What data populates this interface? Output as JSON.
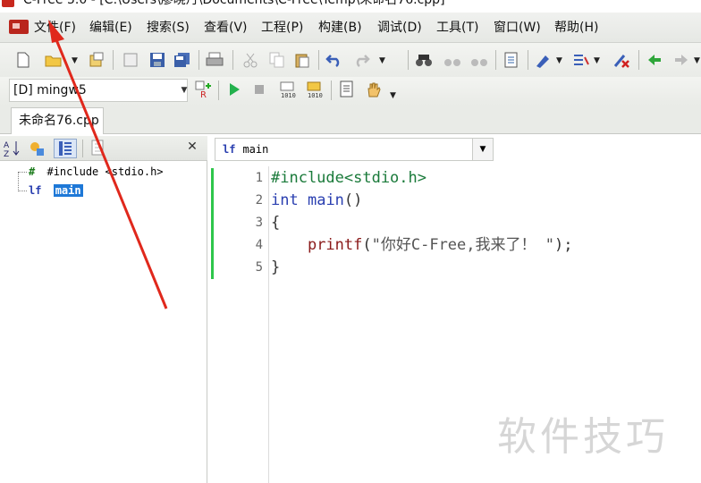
{
  "window": {
    "title": "C-Free 5.0 - [C:\\Users\\廖晓丹\\Documents\\C-Free\\Temp\\未命名76.cpp]"
  },
  "menu": [
    {
      "id": "file",
      "label": "文件(F)"
    },
    {
      "id": "edit",
      "label": "编辑(E)"
    },
    {
      "id": "search",
      "label": "搜索(S)"
    },
    {
      "id": "view",
      "label": "查看(V)"
    },
    {
      "id": "project",
      "label": "工程(P)"
    },
    {
      "id": "build",
      "label": "构建(B)"
    },
    {
      "id": "debug",
      "label": "调试(D)"
    },
    {
      "id": "tools",
      "label": "工具(T)"
    },
    {
      "id": "window",
      "label": "窗口(W)"
    },
    {
      "id": "help",
      "label": "帮助(H)"
    }
  ],
  "toolbar": {
    "compiler_select": "[D] mingw5"
  },
  "tabs": [
    {
      "label": "未命名76.cpp",
      "active": true
    }
  ],
  "symbols": {
    "items": [
      {
        "icon": "hash-icon",
        "label": "#include <stdio.h>"
      },
      {
        "icon": "function-icon",
        "label": "main",
        "selected": true
      }
    ]
  },
  "editor": {
    "function_combo": "main",
    "function_combo_icon": "function-icon",
    "lines": [
      {
        "num": "1",
        "parts": [
          {
            "cls": "c-pre",
            "text": "#include<stdio.h>"
          }
        ]
      },
      {
        "num": "2",
        "parts": [
          {
            "cls": "c-kw",
            "text": "int"
          },
          {
            "cls": "c-pun",
            "text": " "
          },
          {
            "cls": "c-kw",
            "text": "main"
          },
          {
            "cls": "c-pun",
            "text": "()"
          }
        ]
      },
      {
        "num": "3",
        "parts": [
          {
            "cls": "c-pun",
            "text": "{"
          }
        ]
      },
      {
        "num": "4",
        "parts": [
          {
            "cls": "c-pun",
            "text": "    "
          },
          {
            "cls": "c-fn",
            "text": "printf"
          },
          {
            "cls": "c-pun",
            "text": "("
          },
          {
            "cls": "c-str",
            "text": "\"你好C-Free,我来了！ \""
          },
          {
            "cls": "c-pun",
            "text": ");"
          }
        ]
      },
      {
        "num": "5",
        "parts": [
          {
            "cls": "c-pun",
            "text": "}"
          }
        ]
      }
    ]
  },
  "watermark": "软件技巧",
  "colors": {
    "selection": "#1e78d7",
    "arrow": "#e0281c",
    "change_bar": "#2ec64b",
    "brand_red": "#c8281e"
  }
}
